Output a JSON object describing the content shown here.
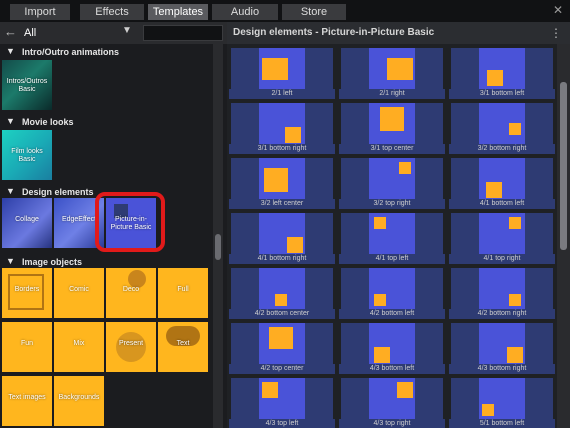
{
  "tabs": [
    {
      "label": "Import",
      "active": false
    },
    {
      "label": "Effects",
      "active": false
    },
    {
      "label": "Templates",
      "active": true
    },
    {
      "label": "Audio",
      "active": false
    },
    {
      "label": "Store",
      "active": false
    }
  ],
  "filter": {
    "label": "All"
  },
  "sections": {
    "intro": "Intro/Outro animations",
    "movie": "Movie looks",
    "design": "Design elements",
    "image": "Image objects"
  },
  "left_tiles": {
    "intro": "Intros/Outros Basic",
    "film": "Film looks Basic",
    "collage": "Collage",
    "edgeeffect": "EdgeEffect",
    "pip": "Picture-in-Picture Basic",
    "borders": "Borders",
    "comic": "Comic",
    "deco": "Deco",
    "full": "Full",
    "fun": "Fun",
    "mix": "Mix",
    "present": "Present",
    "text": "Text",
    "textimages": "Text images",
    "backgrounds": "Backgrounds"
  },
  "right_header": {
    "title": "Design elements - Picture-in-Picture Basic"
  },
  "grid_items": [
    {
      "label": "2/1 left"
    },
    {
      "label": "2/1 right"
    },
    {
      "label": "3/1 bottom left"
    },
    {
      "label": "3/1 bottom right"
    },
    {
      "label": "3/1 top center"
    },
    {
      "label": "3/2 bottom right"
    },
    {
      "label": "3/2 left center"
    },
    {
      "label": "3/2 top right"
    },
    {
      "label": "4/1 bottom left"
    },
    {
      "label": "4/1 bottom right"
    },
    {
      "label": "4/1 top left"
    },
    {
      "label": "4/1 top right"
    },
    {
      "label": "4/2 bottom center"
    },
    {
      "label": "4/2 bottom left"
    },
    {
      "label": "4/2 bottom right"
    },
    {
      "label": "4/2 top center"
    },
    {
      "label": "4/3 bottom left"
    },
    {
      "label": "4/3 bottom right"
    },
    {
      "label": "4/3 top left"
    },
    {
      "label": "4/3 top right"
    },
    {
      "label": "5/1 bottom left"
    }
  ],
  "colors": {
    "accent": "#e11a1a",
    "tile_blue": "#4a53d8",
    "tile_orange": "#ffad22",
    "tile_bg": "#2e3b73"
  }
}
